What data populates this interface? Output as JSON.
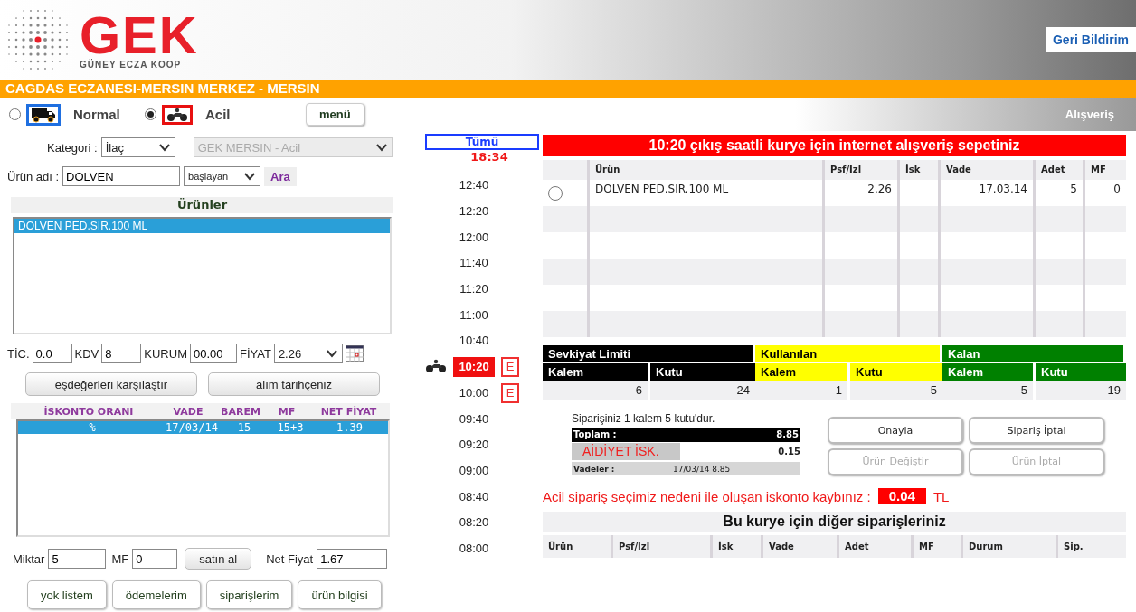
{
  "header": {
    "logo_text": "GEK",
    "logo_subtitle": "GÜNEY ECZA KOOP",
    "feedback_button": "Geri Bildirim"
  },
  "pharmacy_bar": {
    "title": "CAGDAS ECZANESI-MERSIN MERKEZ - MERSIN"
  },
  "delivery_options": [
    {
      "label": "Normal",
      "selected": false,
      "kind": "truck"
    },
    {
      "label": "Acil",
      "selected": true,
      "kind": "motorcycle"
    }
  ],
  "menu_button": "menü",
  "section_title": "Alışveriş",
  "search": {
    "category_label": "Kategori :",
    "category_value": "İlaç",
    "depot_value": "GEK MERSIN - Acil",
    "product_label": "Ürün adı :",
    "product_value": "DOLVEN",
    "match_value": "başlayan",
    "search_button": "Ara"
  },
  "products": {
    "title": "Ürünler",
    "items": [
      {
        "label": "DOLVEN PED.SIR.100 ML",
        "selected": true
      }
    ]
  },
  "price_fields": [
    {
      "label": "TİC.",
      "value": "0.0",
      "kind": "input"
    },
    {
      "label": "KDV",
      "value": "8",
      "kind": "input"
    },
    {
      "label": "KURUM",
      "value": "00.00",
      "kind": "input"
    },
    {
      "label": "FİYAT",
      "value": "2.26",
      "kind": "select"
    }
  ],
  "compare_buttons": [
    "eşdeğerleri karşılaştır",
    "alım tarihçeniz"
  ],
  "discounts": {
    "columns": [
      "İSKONTO ORANI",
      "VADE",
      "BAREM",
      "MF",
      "NET FİYAT"
    ],
    "rows": [
      {
        "cells": [
          "%",
          "17/03/14",
          "15",
          "15+3",
          "1.39"
        ],
        "selected": true
      }
    ]
  },
  "order_fields": {
    "quantity_label": "Miktar",
    "quantity_value": "5",
    "mf_label": "MF",
    "mf_value": "0",
    "buy_button": "satın al",
    "net_label": "Net Fiyat",
    "net_value": "1.67"
  },
  "bottom_buttons": [
    "yok listem",
    "ödemelerim",
    "siparişlerim",
    "ürün bilgisi"
  ],
  "time_slots": {
    "all_label": "Tümü",
    "current_time": "18:34",
    "slots": [
      {
        "time": "12:40",
        "selected": false,
        "courier": false
      },
      {
        "time": "12:20",
        "selected": false,
        "courier": false
      },
      {
        "time": "12:00",
        "selected": false,
        "courier": false
      },
      {
        "time": "11:40",
        "selected": false,
        "courier": false
      },
      {
        "time": "11:20",
        "selected": false,
        "courier": false
      },
      {
        "time": "11:00",
        "selected": false,
        "courier": false
      },
      {
        "time": "10:40",
        "selected": false,
        "courier": false
      },
      {
        "time": "10:20",
        "selected": true,
        "courier": true,
        "badge": "E"
      },
      {
        "time": "10:00",
        "selected": false,
        "courier": false,
        "badge": "E"
      },
      {
        "time": "09:40",
        "selected": false,
        "courier": false
      },
      {
        "time": "09:20",
        "selected": false,
        "courier": false
      },
      {
        "time": "09:00",
        "selected": false,
        "courier": false
      },
      {
        "time": "08:40",
        "selected": false,
        "courier": false
      },
      {
        "time": "08:20",
        "selected": false,
        "courier": false
      },
      {
        "time": "08:00",
        "selected": false,
        "courier": false
      }
    ]
  },
  "cart": {
    "title": "10:20 çıkış saatli kurye için internet alışveriş sepetiniz",
    "columns": [
      "Ürün",
      "Psf/Izl",
      "İsk",
      "Vade",
      "Adet",
      "MF"
    ],
    "rows": [
      {
        "selected": false,
        "product": "DOLVEN PED.SIR.100 ML",
        "price": "2.26",
        "due": "17.03.14",
        "quantity": "5",
        "mf": "0"
      }
    ]
  },
  "limits": [
    {
      "title": "Sevkiyat Limiti",
      "color": "#000000",
      "columns": [
        "Kalem",
        "Kutu"
      ],
      "values": [
        "6",
        "24"
      ]
    },
    {
      "title": "Kullanılan",
      "color": "#ffff00",
      "columns": [
        "Kalem",
        "Kutu"
      ],
      "values": [
        "1",
        "5"
      ]
    },
    {
      "title": "Kalan",
      "color": "#008000",
      "columns": [
        "Kalem",
        "Kutu"
      ],
      "values": [
        "5",
        "19"
      ]
    }
  ],
  "summary": {
    "text": "Siparişiniz 1 kalem 5 kutu'dur.",
    "total_label": "Toplam :",
    "total_value": "8.85",
    "discount_label": "AİDİYET İSK.",
    "discount_value": "0.15",
    "terms_label": "Vadeler :",
    "terms_value": "17/03/14 8.85"
  },
  "actions": [
    {
      "label": "Onayla",
      "disabled": false
    },
    {
      "label": "Sipariş İptal",
      "disabled": false
    },
    {
      "label": "Ürün Değiştir",
      "disabled": true
    },
    {
      "label": "Ürün İptal",
      "disabled": true
    }
  ],
  "loss": {
    "text": "Acil sipariş seçimiz nedeni ile oluşan iskonto kaybınız :",
    "amount": "0.04",
    "currency": "TL"
  },
  "other_orders": {
    "title": "Bu kurye için diğer siparişleriniz",
    "columns": [
      "Ürün",
      "Psf/Izl",
      "İsk",
      "Vade",
      "Adet",
      "MF",
      "Durum",
      "Sip."
    ]
  }
}
